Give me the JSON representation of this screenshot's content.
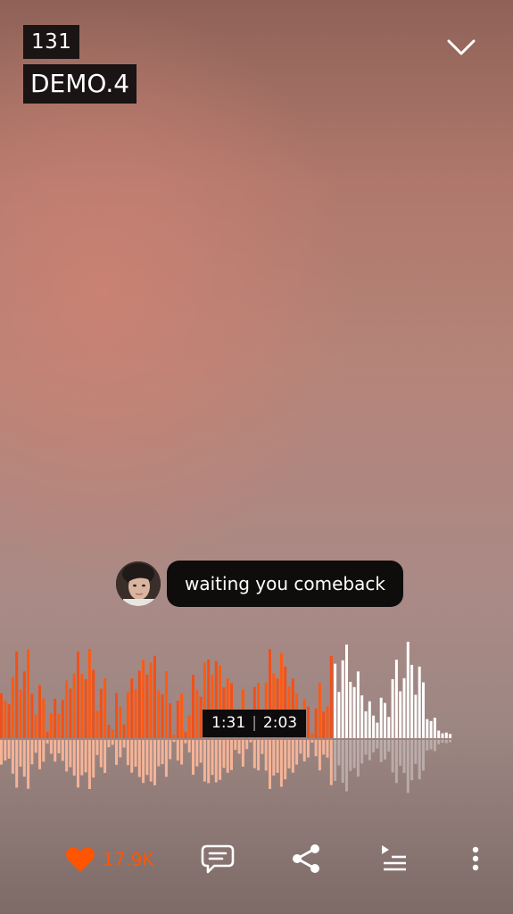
{
  "track": {
    "artist": "131",
    "title": "DEMO.4"
  },
  "comment": {
    "text": "waiting you comeback",
    "avatar_icon": "user-avatar-photo"
  },
  "player": {
    "current_time": "1:31",
    "duration": "2:03",
    "progress": 0.74,
    "played_color": "#ff5500",
    "unplayed_color": "#ffffff"
  },
  "actions": {
    "like_count": "17.9K",
    "icons": [
      "heart-icon",
      "comment-icon",
      "share-icon",
      "queue-icon",
      "more-icon"
    ],
    "accent_color": "#ff5500"
  },
  "header": {
    "collapse_icon": "chevron-down-icon"
  }
}
